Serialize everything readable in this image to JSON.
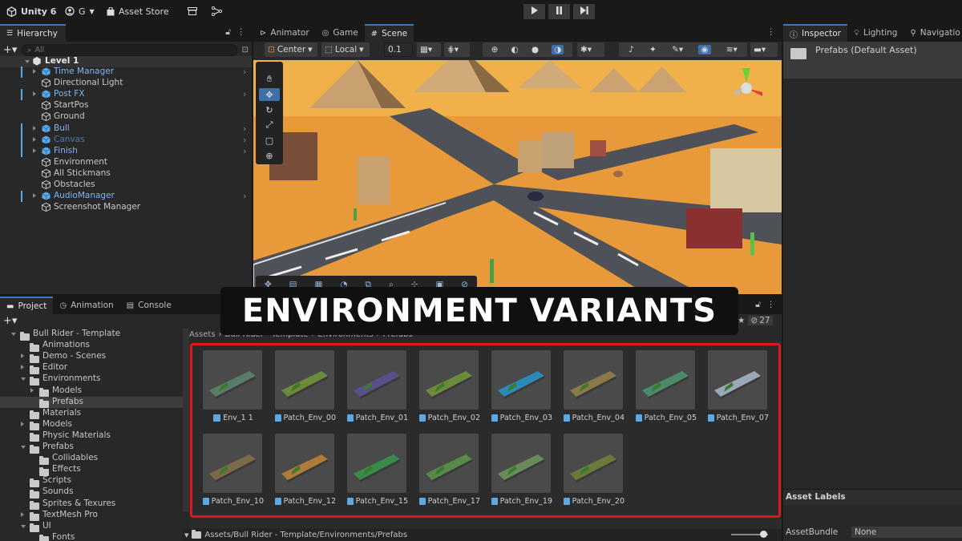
{
  "topbar": {
    "app_label": "Unity 6",
    "account_label": "G",
    "store_label": "Asset Store"
  },
  "hierarchy": {
    "tab_label": "Hierarchy",
    "search_placeholder": "All",
    "root": "Level 1",
    "items": [
      {
        "label": "Time Manager",
        "prefab": true,
        "arrow": true
      },
      {
        "label": "Directional Light",
        "prefab": false,
        "arrow": false
      },
      {
        "label": "Post FX",
        "prefab": true,
        "arrow": true
      },
      {
        "label": "StartPos",
        "prefab": false,
        "arrow": false
      },
      {
        "label": "Ground",
        "prefab": false,
        "arrow": false
      },
      {
        "label": "Bull",
        "prefab": true,
        "arrow": true
      },
      {
        "label": "Canvas",
        "prefab": true,
        "arrow": true
      },
      {
        "label": "Finish",
        "prefab": true,
        "arrow": true
      },
      {
        "label": "Environment",
        "prefab": false,
        "arrow": false
      },
      {
        "label": "All Stickmans",
        "prefab": false,
        "arrow": false
      },
      {
        "label": "Obstacles",
        "prefab": false,
        "arrow": false
      },
      {
        "label": "AudioManager",
        "prefab": true,
        "arrow": true
      },
      {
        "label": "Screenshot Manager",
        "prefab": false,
        "arrow": false
      }
    ]
  },
  "scene": {
    "tabs": [
      "Animator",
      "Game",
      "Scene"
    ],
    "pivot_label": "Center",
    "space_label": "Local",
    "snap_value": "0.1"
  },
  "inspector": {
    "tabs": [
      "Inspector",
      "Lighting",
      "Navigatio"
    ],
    "title": "Prefabs (Default Asset)",
    "asset_labels": "Asset Labels",
    "asset_bundle_label": "AssetBundle",
    "asset_bundle_value": "None"
  },
  "project": {
    "tabs": [
      "Project",
      "Animation",
      "Console"
    ],
    "hidden_count": "27",
    "breadcrumb": [
      "Assets",
      "Bull Rider - Template",
      "Environments",
      "Prefabs"
    ],
    "footer_path": "Assets/Bull Rider - Template/Environments/Prefabs",
    "tree": [
      {
        "label": "Bull Rider - Template",
        "depth": 0,
        "open": true
      },
      {
        "label": "Animations",
        "depth": 1,
        "open": null
      },
      {
        "label": "Demo - Scenes",
        "depth": 1,
        "open": false
      },
      {
        "label": "Editor",
        "depth": 1,
        "open": false
      },
      {
        "label": "Environments",
        "depth": 1,
        "open": true
      },
      {
        "label": "Models",
        "depth": 2,
        "open": false
      },
      {
        "label": "Prefabs",
        "depth": 2,
        "open": null,
        "selected": true
      },
      {
        "label": "Materials",
        "depth": 1,
        "open": null
      },
      {
        "label": "Models",
        "depth": 1,
        "open": false
      },
      {
        "label": "Physic Materials",
        "depth": 1,
        "open": null
      },
      {
        "label": "Prefabs",
        "depth": 1,
        "open": true
      },
      {
        "label": "Collidables",
        "depth": 2,
        "open": null
      },
      {
        "label": "Effects",
        "depth": 2,
        "open": null
      },
      {
        "label": "Scripts",
        "depth": 1,
        "open": null
      },
      {
        "label": "Sounds",
        "depth": 1,
        "open": null
      },
      {
        "label": "Sprites & Texures",
        "depth": 1,
        "open": null
      },
      {
        "label": "TextMesh Pro",
        "depth": 1,
        "open": false
      },
      {
        "label": "UI",
        "depth": 1,
        "open": true
      },
      {
        "label": "Fonts",
        "depth": 2,
        "open": null
      }
    ],
    "assets": [
      {
        "label": "Env_1 1",
        "color": "#5a7a6a"
      },
      {
        "label": "Patch_Env_00",
        "color": "#6b8a3a"
      },
      {
        "label": "Patch_Env_01",
        "color": "#5a4f8a"
      },
      {
        "label": "Patch_Env_02",
        "color": "#6b8a3a"
      },
      {
        "label": "Patch_Env_03",
        "color": "#2a8ab8"
      },
      {
        "label": "Patch_Env_04",
        "color": "#8a7a4a"
      },
      {
        "label": "Patch_Env_05",
        "color": "#4a8a6a"
      },
      {
        "label": "Patch_Env_07",
        "color": "#9aa8b8"
      },
      {
        "label": "Patch_Env_10",
        "color": "#7a6a4a"
      },
      {
        "label": "Patch_Env_12",
        "color": "#b07a3a"
      },
      {
        "label": "Patch_Env_15",
        "color": "#3a8a4a"
      },
      {
        "label": "Patch_Env_17",
        "color": "#5a8a4a"
      },
      {
        "label": "Patch_Env_19",
        "color": "#6a8a5a"
      },
      {
        "label": "Patch_Env_20",
        "color": "#6b7a3a"
      }
    ]
  },
  "overlay": {
    "title": "ENVIRONMENT VARIANTS",
    "highlight_color": "#e0161b"
  }
}
